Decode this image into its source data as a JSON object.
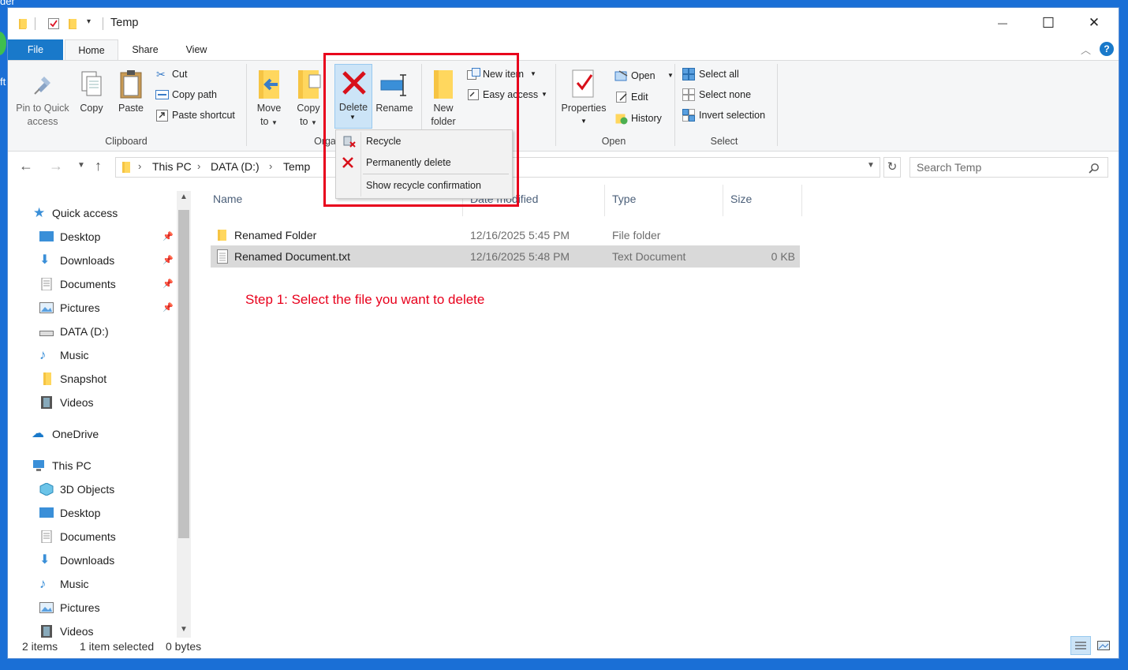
{
  "desktop": {
    "corner_text": "der",
    "corner_text_2": "ft"
  },
  "window": {
    "title": "Temp",
    "controls": {
      "minimize": "—",
      "maximize": "☐",
      "close": "✕"
    }
  },
  "tabs": [
    {
      "label": "File"
    },
    {
      "label": "Home"
    },
    {
      "label": "Share"
    },
    {
      "label": "View"
    }
  ],
  "ribbon": {
    "clipboard": {
      "group_label": "Clipboard",
      "pin_label_1": "Pin to Quick",
      "pin_label_2": "access",
      "copy_label": "Copy",
      "paste_label": "Paste",
      "cut_label": "Cut",
      "copy_path_label": "Copy path",
      "paste_shortcut_label": "Paste shortcut"
    },
    "organize": {
      "group_label": "Orga",
      "move_to_1": "Move",
      "move_to_2": "to",
      "copy_to_1": "Copy",
      "copy_to_2": "to",
      "delete_label": "Delete",
      "rename_label": "Rename"
    },
    "new": {
      "new_folder_1": "New",
      "new_folder_2": "folder",
      "new_item_label": "New item",
      "easy_access_label": "Easy access"
    },
    "open": {
      "group_label": "Open",
      "properties_label": "Properties",
      "open_label": "Open",
      "edit_label": "Edit",
      "history_label": "History"
    },
    "select": {
      "group_label": "Select",
      "select_all_label": "Select all",
      "select_none_label": "Select none",
      "invert_selection_label": "Invert selection"
    }
  },
  "delete_menu": {
    "recycle": "Recycle",
    "permanently_delete": "Permanently delete",
    "show_recycle_confirmation": "Show recycle confirmation"
  },
  "address": {
    "crumbs": [
      "This PC",
      "DATA (D:)",
      "Temp"
    ],
    "search_placeholder": "Search Temp"
  },
  "nav": {
    "quick_access": "Quick access",
    "quick_items": [
      "Desktop",
      "Downloads",
      "Documents",
      "Pictures",
      "DATA (D:)",
      "Music",
      "Snapshot",
      "Videos"
    ],
    "onedrive": "OneDrive",
    "this_pc": "This PC",
    "pc_items": [
      "3D Objects",
      "Desktop",
      "Documents",
      "Downloads",
      "Music",
      "Pictures",
      "Videos"
    ]
  },
  "columns": {
    "name": "Name",
    "date": "Date modified",
    "type": "Type",
    "size": "Size"
  },
  "files": [
    {
      "name": "Renamed Folder",
      "date": "12/16/2025 5:45 PM",
      "type": "File folder",
      "size": ""
    },
    {
      "name": "Renamed Document.txt",
      "date": "12/16/2025 5:48 PM",
      "type": "Text Document",
      "size": "0 KB"
    }
  ],
  "annotation": "Step 1: Select the file you want to delete",
  "status": {
    "count": "2 items",
    "selected": "1 item selected",
    "bytes": "0 bytes"
  },
  "colors": {
    "accent": "#1a6fd6",
    "file_tab": "#1979ca",
    "annotation_red": "#e8001c",
    "selected_row": "#d9d9d9"
  }
}
